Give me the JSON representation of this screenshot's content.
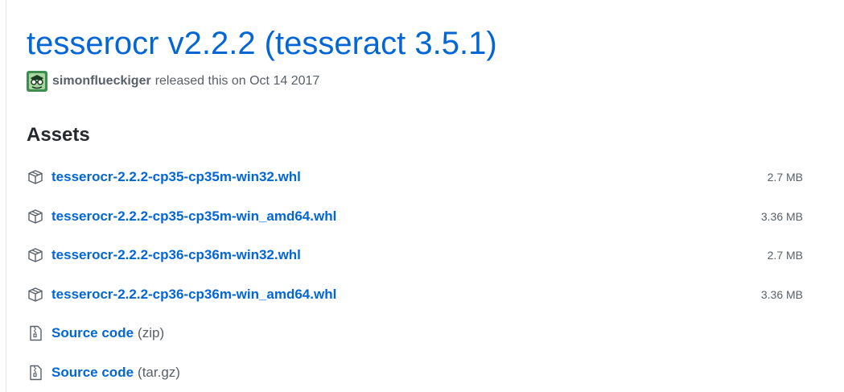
{
  "release": {
    "title": "tesserocr v2.2.2 (tesseract 3.5.1)",
    "author": "simonflueckiger",
    "released_text": "released this on Oct 14 2017"
  },
  "assets": {
    "heading": "Assets",
    "files": [
      {
        "name": "tesserocr-2.2.2-cp35-cp35m-win32.whl",
        "size": "2.7 MB",
        "icon": "package-icon"
      },
      {
        "name": "tesserocr-2.2.2-cp35-cp35m-win_amd64.whl",
        "size": "3.36 MB",
        "icon": "package-icon"
      },
      {
        "name": "tesserocr-2.2.2-cp36-cp36m-win32.whl",
        "size": "2.7 MB",
        "icon": "package-icon"
      },
      {
        "name": "tesserocr-2.2.2-cp36-cp36m-win_amd64.whl",
        "size": "3.36 MB",
        "icon": "package-icon"
      }
    ],
    "source": [
      {
        "label": "Source code",
        "format": "(zip)",
        "icon": "file-zip-icon"
      },
      {
        "label": "Source code",
        "format": "(tar.gz)",
        "icon": "file-zip-icon"
      }
    ]
  },
  "colors": {
    "link": "#0366d6",
    "muted": "#586069",
    "text": "#24292e"
  }
}
